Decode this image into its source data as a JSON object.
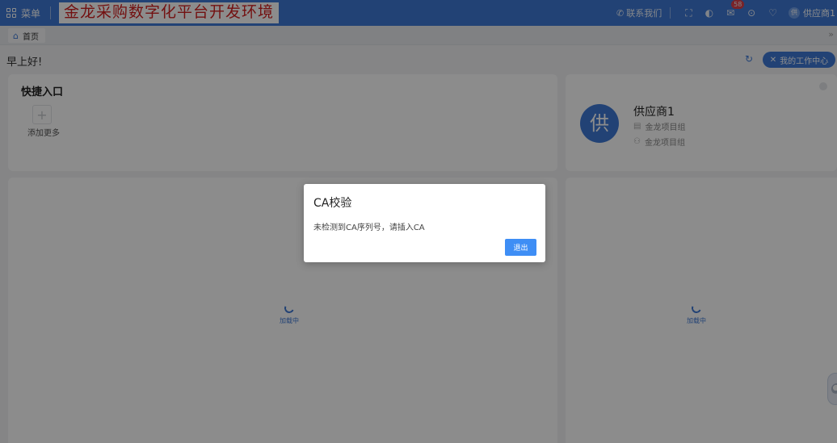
{
  "topbar": {
    "menu_label": "菜单",
    "app_title": "金龙采购数字化平台开发环境",
    "contact_label": "联系我们",
    "fullscreen_icon": "⛶",
    "theme_icon": "◐",
    "mail_icon": "✉",
    "message_count": "58",
    "check_icon": "⊙",
    "bulb_icon": "♡",
    "user_avatar_char": "供",
    "user_name": "供应商1"
  },
  "tabs": {
    "home_label": "首页",
    "collapse_icon": "»"
  },
  "greeting": {
    "text": "早上好!",
    "refresh_icon": "↻",
    "workcenter_label": "我的工作中心"
  },
  "quick_entry": {
    "title": "快捷入口",
    "add_symbol": "+",
    "add_label": "添加更多"
  },
  "user_card": {
    "avatar_char": "供",
    "name": "供应商1",
    "line1": "金龙项目组",
    "line2": "金龙项目组"
  },
  "loading": {
    "left_text": "加载中",
    "right_text": "加载中"
  },
  "modal": {
    "title": "CA校验",
    "body": "未检测到CA序列号，请插入CA",
    "exit_label": "退出"
  },
  "colors": {
    "brand": "#3e79d6",
    "title_red": "#d21f1f",
    "badge_red": "#ee3a3a"
  }
}
